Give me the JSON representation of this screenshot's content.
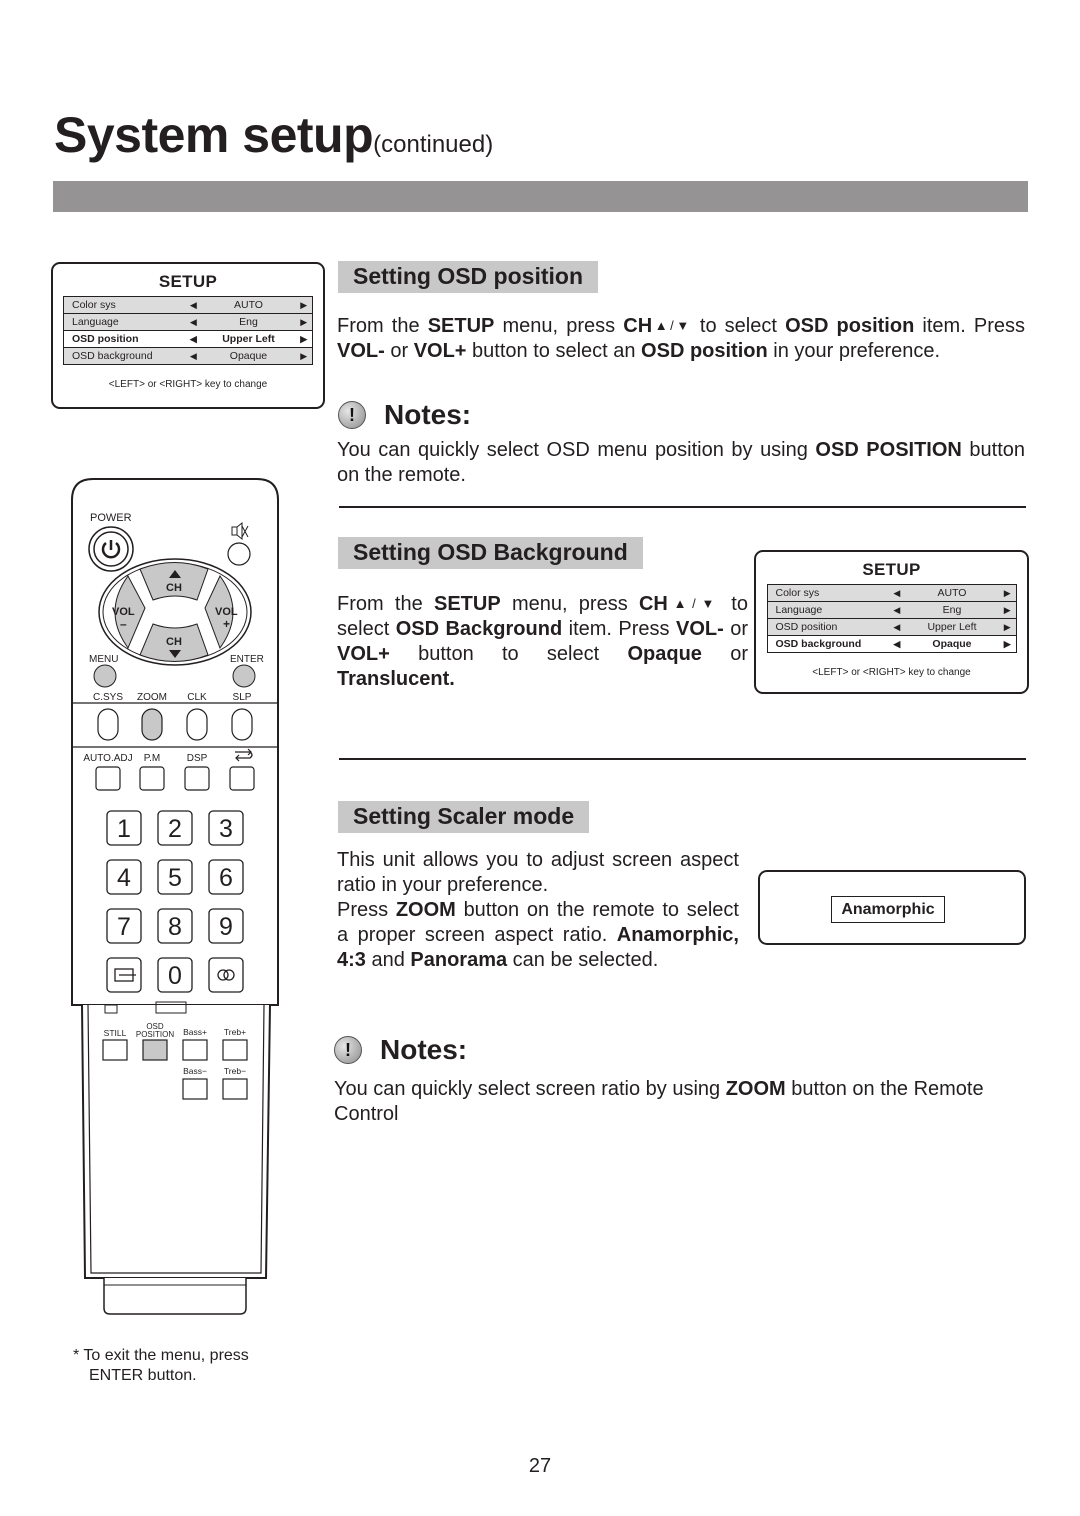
{
  "page": {
    "title": "System setup",
    "title_suffix": "(continued)",
    "page_number": "27"
  },
  "osd_menu_1": {
    "title": "SETUP",
    "rows": [
      {
        "name": "Color sys",
        "value": "AUTO",
        "selected": false
      },
      {
        "name": "Language",
        "value": "Eng",
        "selected": false
      },
      {
        "name": "OSD  position",
        "value": "Upper Left",
        "selected": true
      },
      {
        "name": "OSD background",
        "value": "Opaque",
        "selected": false
      }
    ],
    "hint": "<LEFT> or <RIGHT> key to change",
    "left_arrow": "◀",
    "right_arrow": "▶"
  },
  "osd_menu_2": {
    "title": "SETUP",
    "rows": [
      {
        "name": "Color sys",
        "value": "AUTO",
        "selected": false
      },
      {
        "name": "Language",
        "value": "Eng",
        "selected": false
      },
      {
        "name": "OSD  position",
        "value": "Upper Left",
        "selected": false
      },
      {
        "name": "OSD background",
        "value": "Opaque",
        "selected": true
      }
    ],
    "hint": "<LEFT> or <RIGHT> key to change",
    "left_arrow": "◀",
    "right_arrow": "▶"
  },
  "section_osd_position": {
    "heading": "Setting OSD position",
    "body": [
      {
        "t": "From the ",
        "b": false
      },
      {
        "t": "SETUP",
        "b": true
      },
      {
        "t": " menu, press ",
        "b": false
      },
      {
        "t": "CH",
        "b": true
      },
      {
        "t": "▲/▼",
        "b": false,
        "small": true
      },
      {
        "t": " to select ",
        "b": false
      },
      {
        "t": "OSD position",
        "b": true
      },
      {
        "t": " item. Press ",
        "b": false
      },
      {
        "t": "VOL-",
        "b": true
      },
      {
        "t": " or ",
        "b": false
      },
      {
        "t": "VOL+",
        "b": true
      },
      {
        "t": " button to select an ",
        "b": false
      },
      {
        "t": "OSD position",
        "b": true
      },
      {
        "t": " in your preference.",
        "b": false
      }
    ],
    "notes_heading": "Notes:",
    "notes_icon": "!",
    "notes": [
      {
        "t": "You can quickly select OSD menu position by using ",
        "b": false
      },
      {
        "t": "OSD POSITION",
        "b": true
      },
      {
        "t": " button on the remote.",
        "b": false
      }
    ]
  },
  "section_osd_background": {
    "heading": "Setting OSD Background",
    "body": [
      {
        "t": "From the ",
        "b": false
      },
      {
        "t": "SETUP",
        "b": true
      },
      {
        "t": " menu, press ",
        "b": false
      },
      {
        "t": "CH",
        "b": true
      },
      {
        "t": "▲/▼",
        "b": false,
        "small": true
      },
      {
        "t": " to select ",
        "b": false
      },
      {
        "t": "OSD Background",
        "b": true
      },
      {
        "t": " item. Press ",
        "b": false
      },
      {
        "t": "VOL-",
        "b": true
      },
      {
        "t": " or ",
        "b": false
      },
      {
        "t": "VOL+",
        "b": true
      },
      {
        "t": " button to select ",
        "b": false
      },
      {
        "t": "Opaque",
        "b": true
      },
      {
        "t": " or ",
        "b": false
      },
      {
        "t": "Translucent.",
        "b": true
      }
    ]
  },
  "section_scaler": {
    "heading": "Setting Scaler mode",
    "body": [
      {
        "t": "This unit allows you to adjust screen aspect ratio in your preference.",
        "b": false,
        "br": true
      },
      {
        "t": "Press ",
        "b": false
      },
      {
        "t": "ZOOM",
        "b": true
      },
      {
        "t": " button on the remote to select a proper screen aspect ratio. ",
        "b": false
      },
      {
        "t": "Anamorphic, 4:3",
        "b": true
      },
      {
        "t": " and ",
        "b": false
      },
      {
        "t": "Panorama",
        "b": true
      },
      {
        "t": " can be selected.",
        "b": false
      }
    ],
    "aspect_display": "Anamorphic",
    "notes_heading": "Notes:",
    "notes_icon": "!",
    "notes": [
      {
        "t": "You can quickly select screen ratio by using ",
        "b": false
      },
      {
        "t": "ZOOM",
        "b": true
      },
      {
        "t": " button on the Remote Control",
        "b": false
      }
    ]
  },
  "remote": {
    "power_label": "POWER",
    "mute_icon": "mute",
    "ch_up": "CH",
    "ch_down": "CH",
    "vol_minus": "VOL",
    "vol_minus_sign": "–",
    "vol_plus": "VOL",
    "vol_plus_sign": "+",
    "menu_label": "MENU",
    "enter_label": "ENTER",
    "row1_labels": [
      "C.SYS",
      "ZOOM",
      "CLK",
      "SLP"
    ],
    "row2_labels": [
      "AUTO.ADJ",
      "P.M",
      "DSP"
    ],
    "digits": [
      "1",
      "2",
      "3",
      "4",
      "5",
      "6",
      "7",
      "8",
      "9",
      "0"
    ],
    "lower_labels_top": [
      "STILL",
      "OSD",
      "POSITION",
      "Bass+",
      "Treb+"
    ],
    "lower_labels_bottom": [
      "Bass−",
      "Treb−"
    ],
    "highlight_color": "#c8c8c8"
  },
  "footnote": {
    "line1": "* To exit the menu, press",
    "line2": "ENTER button."
  }
}
